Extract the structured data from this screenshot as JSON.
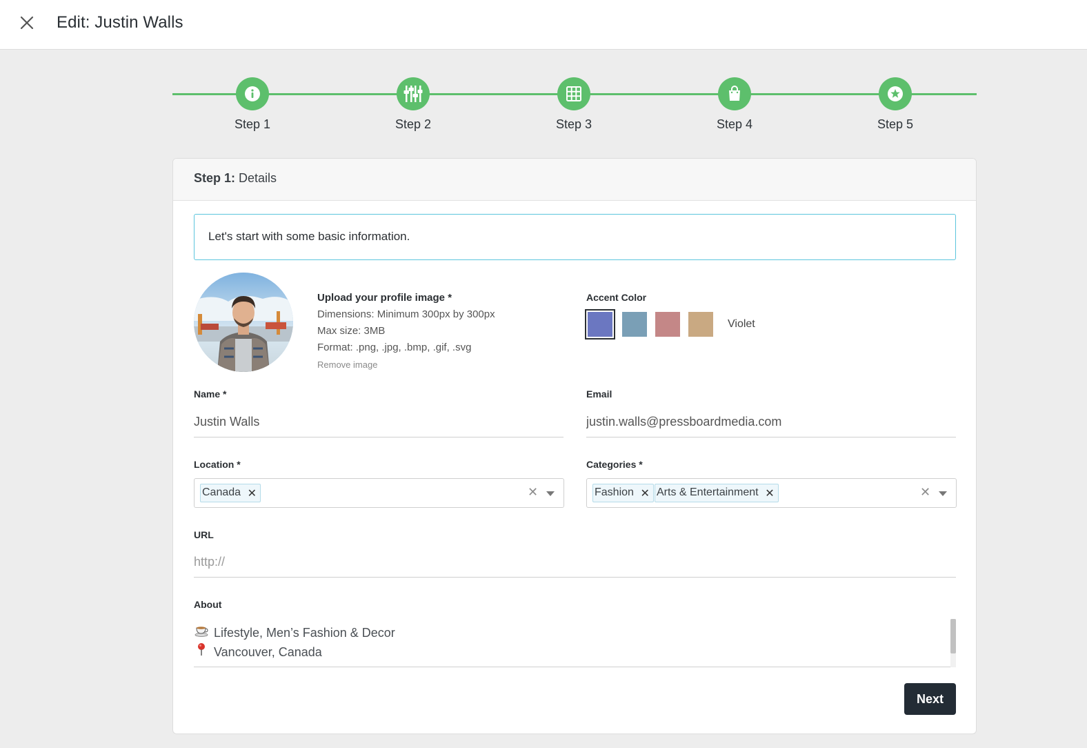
{
  "header": {
    "title": "Edit: Justin Walls"
  },
  "stepper": {
    "steps": [
      {
        "label": "Step 1",
        "icon": "info-icon"
      },
      {
        "label": "Step 2",
        "icon": "sliders-icon"
      },
      {
        "label": "Step 3",
        "icon": "grid-icon"
      },
      {
        "label": "Step 4",
        "icon": "shopping-bag-icon"
      },
      {
        "label": "Step 5",
        "icon": "star-badge-icon"
      }
    ],
    "active_color": "#5dbf6c"
  },
  "card": {
    "step_prefix": "Step 1:",
    "step_title": "Details",
    "intro": "Let's start with some basic information."
  },
  "profile_image": {
    "title": "Upload your profile image *",
    "dimensions": "Dimensions: Minimum 300px by 300px",
    "max_size": "Max size: 3MB",
    "format": "Format: .png, .jpg, .bmp, .gif, .svg",
    "remove": "Remove image"
  },
  "accent": {
    "label": "Accent Color",
    "swatches": [
      "#6b77c1",
      "#7a9fb6",
      "#c48787",
      "#c9a982"
    ],
    "selected_name": "Violet"
  },
  "fields": {
    "name": {
      "label": "Name *",
      "value": "Justin Walls"
    },
    "email": {
      "label": "Email",
      "value": "justin.walls@pressboardmedia.com"
    },
    "location": {
      "label": "Location *",
      "tags": [
        "Canada"
      ]
    },
    "categories": {
      "label": "Categories *",
      "tags": [
        "Fashion",
        "Arts & Entertainment"
      ]
    },
    "url": {
      "label": "URL",
      "placeholder": "http://"
    },
    "about": {
      "label": "About",
      "lines": [
        {
          "icon": "teacup-icon",
          "text": "Lifestyle, Men’s Fashion & Decor"
        },
        {
          "icon": "pushpin-icon",
          "text": "Vancouver, Canada"
        }
      ]
    }
  },
  "actions": {
    "next_label": "Next"
  }
}
